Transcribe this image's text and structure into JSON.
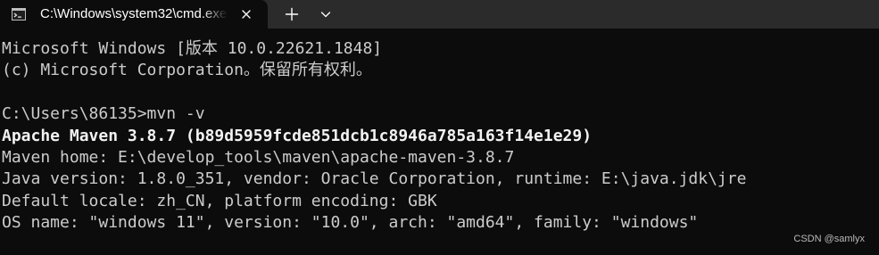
{
  "tab": {
    "title": "C:\\Windows\\system32\\cmd.exe"
  },
  "toolbar": {
    "new_tab_icon": "plus-icon",
    "dropdown_icon": "chevron-down-icon"
  },
  "console": {
    "lines": [
      "Microsoft Windows [版本 10.0.22621.1848]",
      "(c) Microsoft Corporation。保留所有权利。",
      "",
      "C:\\Users\\86135>mvn -v",
      "Apache Maven 3.8.7 (b89d5959fcde851dcb1c8946a785a163f14e1e29)",
      "Maven home: E:\\develop_tools\\maven\\apache-maven-3.8.7",
      "Java version: 1.8.0_351, vendor: Oracle Corporation, runtime: E:\\java.jdk\\jre",
      "Default locale: zh_CN, platform encoding: GBK",
      "OS name: \"windows 11\", version: \"10.0\", arch: \"amd64\", family: \"windows\""
    ]
  },
  "watermark": "CSDN @samlyx",
  "colors": {
    "background": "#0c0c0c",
    "titlebar": "#2b2b2b",
    "text": "#cccccc",
    "bold_text": "#f2f2f2"
  }
}
